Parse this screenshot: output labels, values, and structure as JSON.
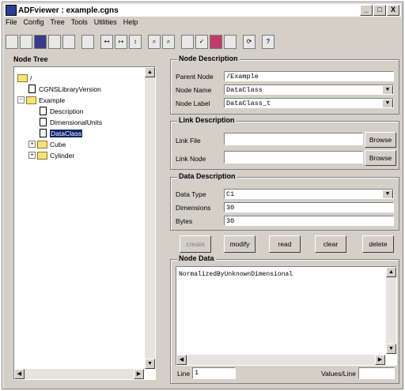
{
  "window": {
    "title": "ADFviewer : example.cgns",
    "controls": [
      "_",
      "□",
      "X"
    ]
  },
  "menu": [
    "File",
    "Config",
    "Tree",
    "Tools",
    "Utilities",
    "Help"
  ],
  "toolbar": {
    "icons": [
      "new-icon",
      "open-icon",
      "save-icon",
      "save-as-icon",
      "export-icon",
      "view-icon",
      "move-left-icon",
      "move-right-icon",
      "sort-icon",
      "zoom-in-icon",
      "zoom-fit-icon",
      "copy-icon",
      "check-icon",
      "palette-icon",
      "grid-icon",
      "refresh-icon",
      "help-icon"
    ],
    "help_label": "?"
  },
  "tree": {
    "title": "Node Tree",
    "nodes": {
      "root": "/",
      "lib": "CGNSLibraryVersion",
      "example": "Example",
      "description": "Description",
      "dimunits": "DimensionalUnits",
      "dataclass": "DataClass",
      "cube": "Cube",
      "cylinder": "Cylinder"
    }
  },
  "node_desc": {
    "title": "Node Description",
    "parent_label": "Parent Node",
    "parent_value": "/Example",
    "name_label": "Node Name",
    "name_value": "DataClass",
    "nlabel_label": "Node Label",
    "nlabel_value": "DataClass_t"
  },
  "link_desc": {
    "title": "Link Description",
    "file_label": "Link File",
    "file_value": "",
    "node_label": "Link Node",
    "node_value": "",
    "browse": "Browse"
  },
  "data_desc": {
    "title": "Data Description",
    "type_label": "Data Type",
    "type_value": "C1",
    "dims_label": "Dimensions",
    "dims_value": "30",
    "bytes_label": "Bytes",
    "bytes_value": "30"
  },
  "actions": {
    "create": "create",
    "modify": "modify",
    "read": "read",
    "clear": "clear",
    "delete": "delete"
  },
  "node_data": {
    "title": "Node Data",
    "content": "NormalizedByUnknownDimensional",
    "line_label": "Line",
    "line_value": "1",
    "values_label": "Values/Line",
    "values_value": ""
  }
}
